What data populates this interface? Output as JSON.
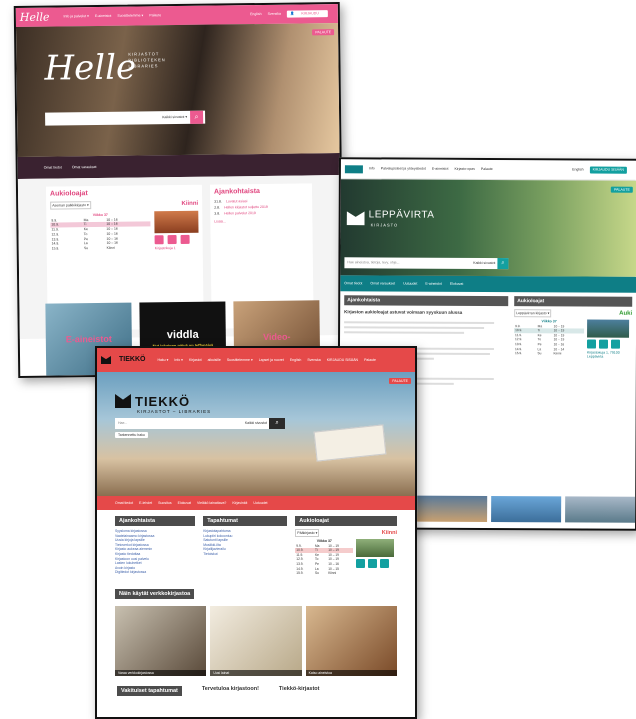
{
  "helle": {
    "logo": "Helle",
    "nav": [
      "Info ja palvelut ▾",
      "E-aineistot",
      "Suosittelemme ▾",
      "Palaute"
    ],
    "lang": [
      "English",
      "Svenska"
    ],
    "login": "KIRJAUDU",
    "feedback": "PALAUTE",
    "hero_sub": [
      "KIRJASTOT",
      "BIBLIOTEKEN",
      "LIBRARIES"
    ],
    "search_scope": "Kaikki sivustot ▾",
    "search_icon": "search-icon",
    "band": [
      "Omat tiedot",
      "Omat varaukset"
    ],
    "hours_title": "Aukioloajat",
    "library_select": "Aseman palkkikirjasto ▾",
    "status": "Kiinni",
    "week": "Viikko 37",
    "hours": [
      [
        "9.9.",
        "Ma",
        "10 – 16"
      ],
      [
        "10.9.",
        "Ti",
        "10 – 16"
      ],
      [
        "11.9.",
        "Ke",
        "10 – 16"
      ],
      [
        "12.9.",
        "To",
        "10 – 16"
      ],
      [
        "13.9.",
        "Pe",
        "10 – 16"
      ],
      [
        "14.9.",
        "La",
        "10 – 16"
      ],
      [
        "15.9.",
        "Su",
        "Kiinni"
      ]
    ],
    "address": "Kirjastokuja 1",
    "news_title": "Ajankohtaista",
    "news": [
      [
        "31.8.",
        "Luvatut asiasi"
      ],
      [
        "2.8.",
        "Hellen kirjastot suljettu 2019"
      ],
      [
        "3.8.",
        "Hellen palvelut 2019"
      ]
    ],
    "news_more": "Lisää...",
    "tiles": [
      "E-aineistot",
      "viddla",
      "Video-"
    ],
    "viddla_sub": "Nyt jokainen päivä on leffapäivä"
  },
  "leppavirta": {
    "nav": [
      "Info",
      "Palvelupisteet ja yhteystiedot",
      "E-aineistot",
      "Kirjasto-opas",
      "Palaute"
    ],
    "lang": "English",
    "login": "KIRJAUDU SISÄÄN",
    "feedback": "PALAUTE",
    "title": "LEPPÄVIRTA",
    "subtitle": "KIRJASTO",
    "search_placeholder": "Hae aineistoa, tietoja, levy, ohje...",
    "search_scope": "Kaikki sivustot",
    "band": [
      "Omat tiedot",
      "Omat varaukset",
      "Uutuudet",
      "E-aineistot",
      "Elokuvat"
    ],
    "news_title": "Ajankohtaista",
    "news_head": "Kirjaston aukioloajat astuvat voimaan syyskuun alussa",
    "hours_title": "Aukioloajat",
    "library_select": "Leppävirran kirjasto ▾",
    "status": "Auki",
    "week": "Viikko 37",
    "hours": [
      [
        "9.9.",
        "Ma",
        "10 – 19"
      ],
      [
        "10.9.",
        "Ti",
        "10 – 19"
      ],
      [
        "11.9.",
        "Ke",
        "10 – 19"
      ],
      [
        "12.9.",
        "To",
        "10 – 19"
      ],
      [
        "13.9.",
        "Pe",
        "10 – 16"
      ],
      [
        "14.9.",
        "La",
        "10 – 14"
      ],
      [
        "15.9.",
        "Su",
        "Kiinni"
      ]
    ],
    "address": "Kirjastokuja 1, 79100 Leppävirta"
  },
  "tiekko": {
    "nav": [
      "Haku ▾",
      "Info ▾",
      "Kirjastot",
      "aikuisille",
      "Suosittelemme ▾",
      "Lapset ja nuoret",
      "Palaute"
    ],
    "lang": [
      "English",
      "Svenska"
    ],
    "login": "KIRJAUDU SISÄÄN",
    "feedback": "PALAUTE",
    "logo_title": "TIEKKÖ",
    "logo_sub": "KIRJASTOT – LIBRARIES",
    "search_placeholder": "Hae...",
    "search_scope": "Kaikki sivustot",
    "advanced": "Tarkennettu haku",
    "band": [
      "Omat tiedot",
      "E-lehdet",
      "Suositus",
      "Elokuvat",
      "Vieläkö lainattava?",
      "Kirjavinkit",
      "Uutuudet"
    ],
    "col_news": "Ajankohtaista",
    "news": [
      "Syysloma kirjastossa",
      "Vaatelainaamo kirjastossa",
      "Uusia kirjoja lapsille",
      "Tietoverkot kirjastossa",
      "Kirjasto aukeaa aiemmin",
      "Kirjasto tiedottaa",
      "Kirjastoon uusi palvelu",
      "Lasten lukuhetket",
      "Avoin kirjasto",
      "Digitiedot kirjastossa"
    ],
    "col_events": "Tapahtumat",
    "events": [
      "Kirjastotapahtuma",
      "Lukupiiri kokoontuu",
      "Satutunti lapsille",
      "Musiikki-ilta",
      "Kirjailijavierailu",
      "Tietoiskut"
    ],
    "col_hours": "Aukioloajat",
    "library_select": "Pääkirjasto ▾",
    "status": "Kiinni",
    "week": "Viikko 37",
    "hours": [
      [
        "9.9.",
        "Ma",
        "10 – 19"
      ],
      [
        "10.9.",
        "Ti",
        "10 – 19"
      ],
      [
        "11.9.",
        "Ke",
        "10 – 19"
      ],
      [
        "12.9.",
        "To",
        "10 – 19"
      ],
      [
        "13.9.",
        "Pe",
        "10 – 16"
      ],
      [
        "14.9.",
        "La",
        "10 – 15"
      ],
      [
        "15.9.",
        "Su",
        "Kiinni"
      ]
    ],
    "online_title": "Näin käytät verkkokirjastoa",
    "slides": [
      "Varaa verkkokirjastossa",
      "Uusi lainat",
      "Katso aineistoa"
    ],
    "footer": [
      "Vakituiset tapahtumat",
      "Tervetuloa kirjastoon!",
      "Tiekkö-kirjastot"
    ]
  }
}
